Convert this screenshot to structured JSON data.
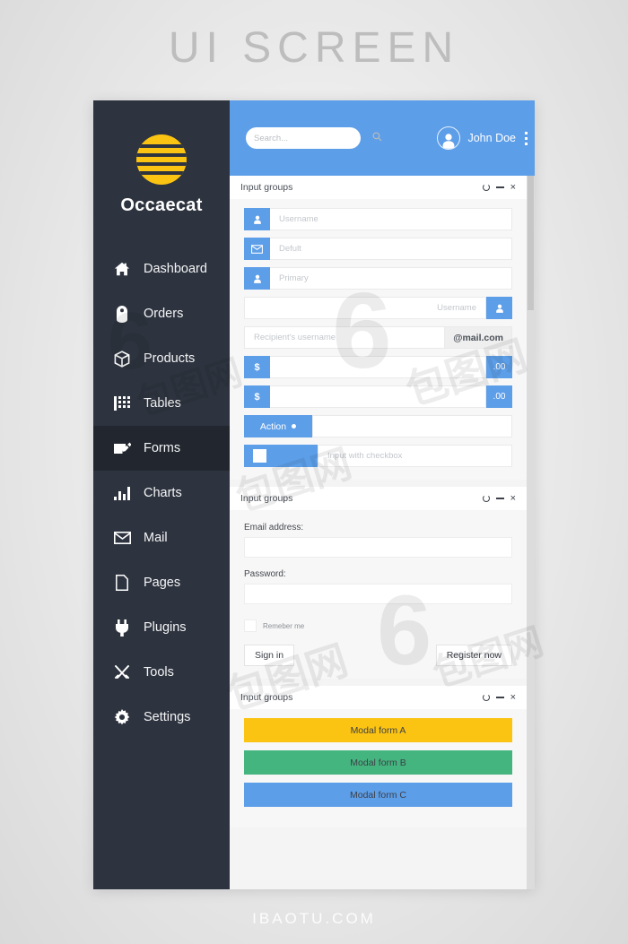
{
  "outer": {
    "title": "UI SCREEN",
    "footer": "IBAOTU.COM"
  },
  "colors": {
    "sidebar_bg": "#2e343f",
    "sidebar_active": "#22272f",
    "header_blue": "#5d9ee8",
    "accent_blue": "#5d9ee8",
    "logo_yellow": "#fbc412",
    "modal_a": "#fbc412",
    "modal_b": "#45b57f",
    "modal_c": "#5d9ee8"
  },
  "sidebar": {
    "brand": "Occaecat",
    "logo_icon": "striped-circle-logo",
    "items": [
      {
        "label": "Dashboard",
        "icon": "home-icon",
        "active": false
      },
      {
        "label": "Orders",
        "icon": "tag-icon",
        "active": false
      },
      {
        "label": "Products",
        "icon": "box-icon",
        "active": false
      },
      {
        "label": "Tables",
        "icon": "grid-icon",
        "active": false
      },
      {
        "label": "Forms",
        "icon": "form-edit-icon",
        "active": true
      },
      {
        "label": "Charts",
        "icon": "bar-chart-icon",
        "active": false
      },
      {
        "label": "Mail",
        "icon": "envelope-icon",
        "active": false
      },
      {
        "label": "Pages",
        "icon": "page-icon",
        "active": false
      },
      {
        "label": "Plugins",
        "icon": "plug-icon",
        "active": false
      },
      {
        "label": "Tools",
        "icon": "tools-icon",
        "active": false
      },
      {
        "label": "Settings",
        "icon": "gear-icon",
        "active": false
      }
    ]
  },
  "topbar": {
    "search_placeholder": "Search...",
    "search_value": "",
    "search_icon": "search-icon",
    "user_name": "John Doe",
    "avatar_icon": "user-avatar-icon",
    "menu_icon": "kebab-menu-icon"
  },
  "panel_controls": {
    "refresh_icon": "refresh-icon",
    "minimize_icon": "minimize-icon",
    "close_icon": "close-icon",
    "close_glyph": "×"
  },
  "panels": [
    {
      "title": "Input groups",
      "inputs": [
        {
          "type": "left-icon",
          "icon": "user-icon",
          "placeholder": "Username"
        },
        {
          "type": "left-icon",
          "icon": "envelope-icon",
          "placeholder": "Defult"
        },
        {
          "type": "left-icon",
          "icon": "user-icon",
          "placeholder": "Primary"
        },
        {
          "type": "right-icon",
          "icon": "user-icon",
          "placeholder": "Username"
        },
        {
          "type": "right-text",
          "addon": "@mail.com",
          "placeholder": "Recipient's username"
        },
        {
          "type": "dollar",
          "prefix": "$",
          "suffix": ".00",
          "placeholder": ""
        },
        {
          "type": "dollar",
          "prefix": "$",
          "suffix": ".00",
          "placeholder": ""
        },
        {
          "type": "action",
          "label": "Action",
          "caret_icon": "caret-down-icon",
          "placeholder": ""
        },
        {
          "type": "checkbox",
          "checkbox_icon": "checkbox-icon",
          "placeholder": "Input with checkbox"
        }
      ]
    },
    {
      "title": "Input groups",
      "form": {
        "email_label": "Email address:",
        "email_value": "",
        "password_label": "Password:",
        "password_value": "",
        "remember_label": "Remeber me",
        "remember_checkbox_icon": "checkbox-icon",
        "signin_label": "Sign in",
        "register_label": "Register now"
      }
    },
    {
      "title": "Input groups",
      "modal_buttons": [
        {
          "label": "Modal form A",
          "color": "#fbc412"
        },
        {
          "label": "Modal form B",
          "color": "#45b57f"
        },
        {
          "label": "Modal form C",
          "color": "#5d9ee8"
        }
      ]
    }
  ]
}
